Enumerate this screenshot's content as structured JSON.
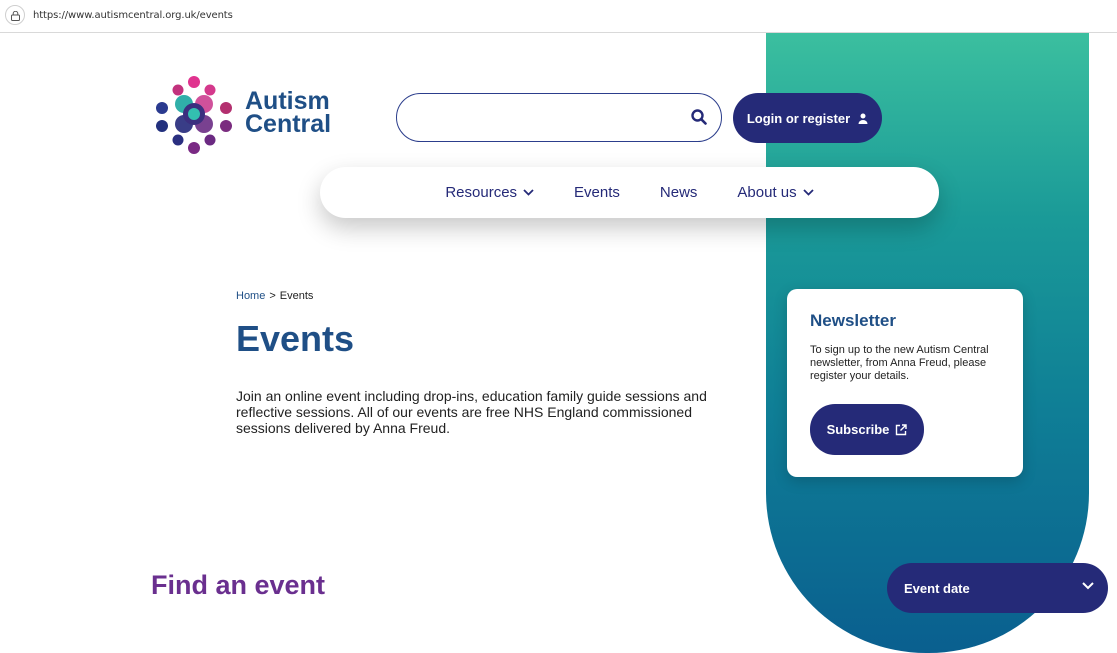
{
  "browser": {
    "url": "https://www.autismcentral.org.uk/events"
  },
  "brand": {
    "line1": "Autism",
    "line2": "Central"
  },
  "header": {
    "search_placeholder": "",
    "login_label": "Login or register"
  },
  "nav": {
    "items": [
      {
        "label": "Resources",
        "dropdown": true
      },
      {
        "label": "Events",
        "dropdown": false
      },
      {
        "label": "News",
        "dropdown": false
      },
      {
        "label": "About us",
        "dropdown": true
      }
    ]
  },
  "breadcrumb": {
    "home": "Home",
    "separator": ">",
    "current": "Events"
  },
  "page": {
    "title": "Events",
    "intro": "Join an online event including drop-ins, education family guide sessions and reflective sessions. All of our events are free NHS England commissioned sessions delivered by Anna Freud."
  },
  "newsletter": {
    "title": "Newsletter",
    "text": "To sign up to the new Autism Central newsletter, from Anna Freud, please register your details.",
    "button_label": "Subscribe"
  },
  "find": {
    "title": "Find an event",
    "filter_label": "Event date"
  },
  "colors": {
    "primary": "#252a78",
    "heading_blue": "#1f4f86",
    "purple": "#6a2f8f",
    "gradient_top": "#3bbf9f",
    "gradient_bottom": "#0a5f8f"
  }
}
